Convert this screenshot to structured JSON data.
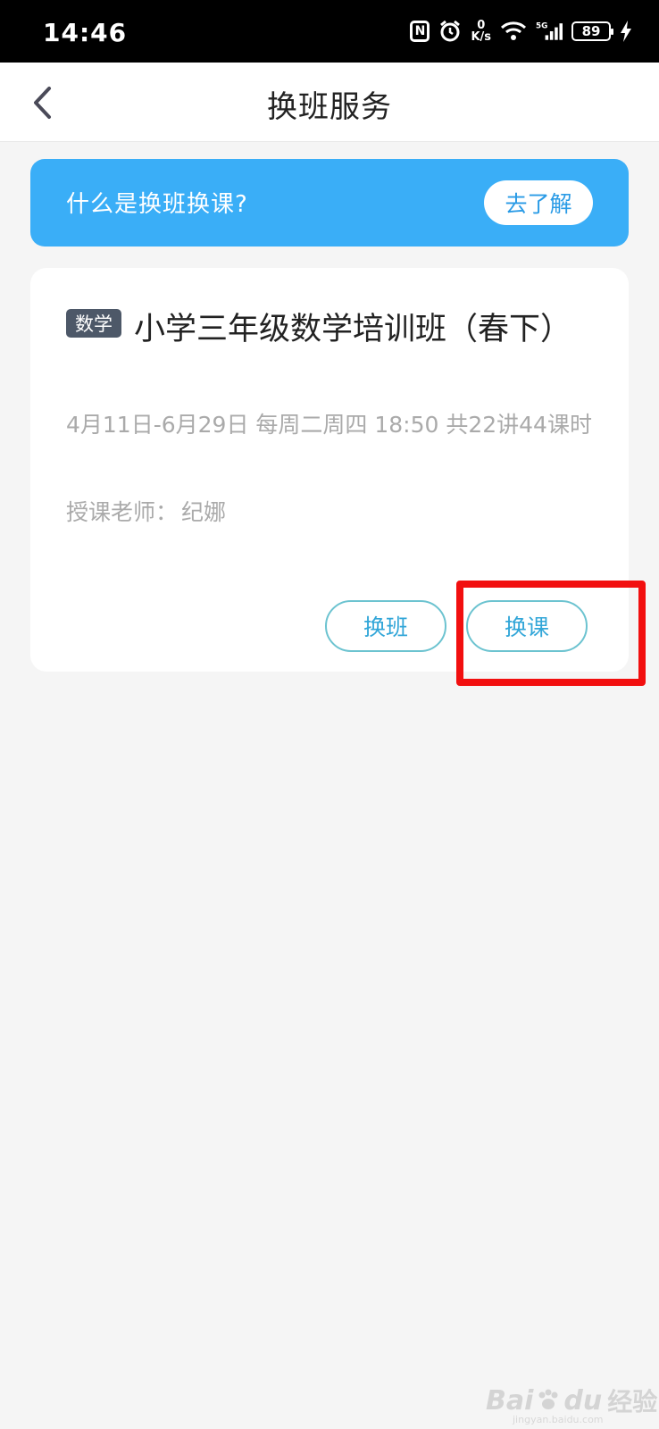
{
  "status_bar": {
    "time": "14:46",
    "speed_value": "0",
    "speed_unit": "K/s",
    "network": "5G",
    "battery": "89"
  },
  "nav": {
    "title": "换班服务",
    "back_icon": "chevron-left-icon"
  },
  "banner": {
    "text": "什么是换班换课?",
    "button_label": "去了解",
    "color": "#3aaef7"
  },
  "course": {
    "subject_tag": "数学",
    "title": "小学三年级数学培训班（春下）",
    "schedule": "4月11日-6月29日 每周二周四 18:50 共22讲44课时",
    "teacher_label": "授课老师：",
    "teacher_name": "纪娜",
    "switch_class_label": "换班",
    "switch_lesson_label": "换课"
  },
  "watermark": {
    "brand_left": "Bai",
    "brand_right": "du",
    "brand_cn": "经验",
    "url": "jingyan.baidu.com"
  }
}
